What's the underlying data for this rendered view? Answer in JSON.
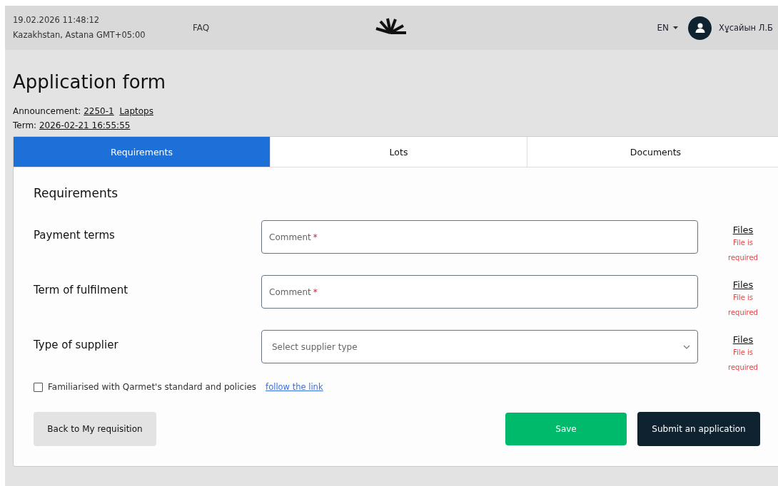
{
  "header": {
    "datetime": "19.02.2026 11:48:12",
    "timezone": "Kazakhstan, Astana GMT+05:00",
    "faq": "FAQ",
    "language": "EN",
    "user_name": "Хұсайын Л.Б"
  },
  "page": {
    "title": "Application form",
    "announcement_label": "Announcement:",
    "announcement_number": "2250-1",
    "announcement_name": "Laptops",
    "term_label": "Term:",
    "term_value": "2026-02-21 16:55:55"
  },
  "tabs": [
    {
      "label": "Requirements",
      "selected": true
    },
    {
      "label": "Lots",
      "selected": false
    },
    {
      "label": "Documents",
      "selected": false
    }
  ],
  "section_title": "Requirements",
  "requirements": [
    {
      "label": "Payment terms",
      "kind": "text",
      "placeholder": "Comment",
      "required_mark": "*",
      "files_link": "Files",
      "files_error": "File is required"
    },
    {
      "label": "Term of fulfilment",
      "kind": "text",
      "placeholder": "Comment",
      "required_mark": "*",
      "files_link": "Files",
      "files_error": "File is required"
    },
    {
      "label": "Type of supplier",
      "kind": "select",
      "placeholder": "Select supplier type",
      "files_link": "Files",
      "files_error": "File is required"
    }
  ],
  "agreement": {
    "label": "Familiarised with Qarmet's standard and policies",
    "checked": false,
    "link": "follow the link"
  },
  "buttons": {
    "back": "Back to My requisition",
    "save": "Save",
    "submit": "Submit an application"
  }
}
